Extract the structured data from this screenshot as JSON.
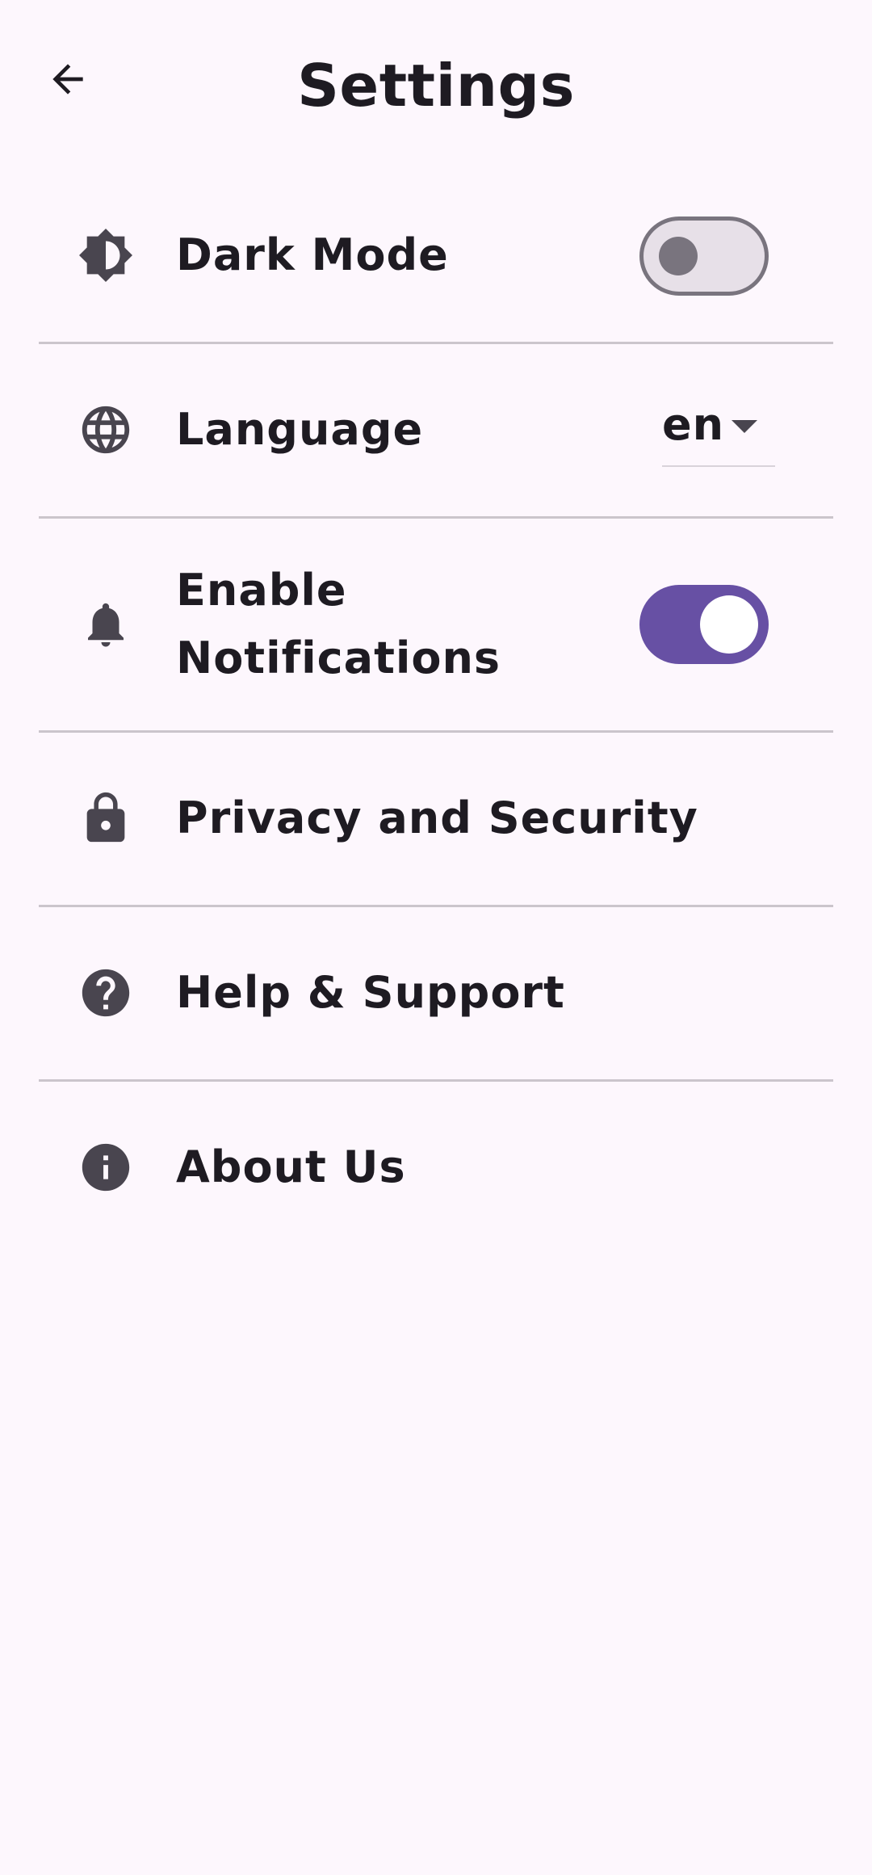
{
  "header": {
    "title": "Settings",
    "back_icon": "arrow-back-icon"
  },
  "settings": {
    "dark_mode": {
      "icon": "brightness-contrast-icon",
      "label": "Dark Mode",
      "enabled": false
    },
    "language": {
      "icon": "globe-icon",
      "label": "Language",
      "selected": "en"
    },
    "notifications": {
      "icon": "bell-icon",
      "label": "Enable Notifications",
      "enabled": true
    },
    "privacy": {
      "icon": "lock-icon",
      "label": "Privacy and Security"
    },
    "help": {
      "icon": "help-circle-icon",
      "label": "Help & Support"
    },
    "about": {
      "icon": "info-circle-icon",
      "label": "About Us"
    }
  },
  "colors": {
    "background": "#fdf7fd",
    "primary": "#6750a4",
    "divider": "#cbc5cc",
    "text": "#1e1b22",
    "icon": "#49454f"
  }
}
